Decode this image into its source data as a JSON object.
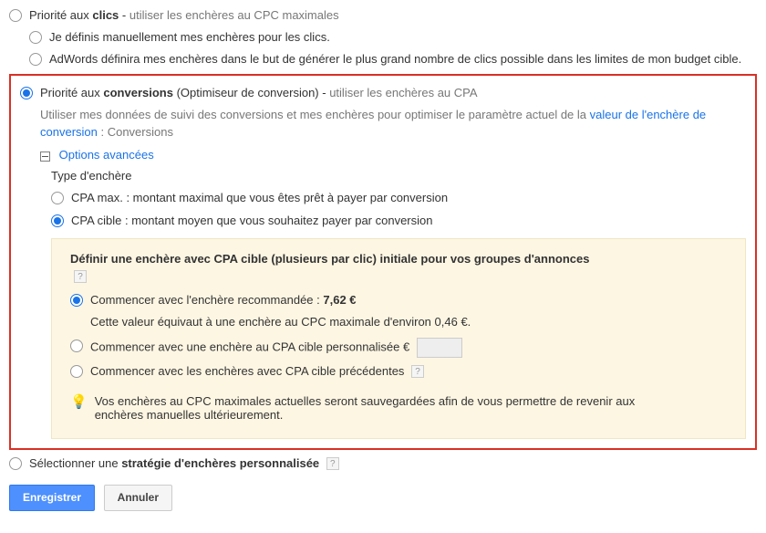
{
  "option_clicks": {
    "prefix": "Priorité aux ",
    "bold": "clics",
    "suffix": " - ",
    "hint": "utiliser les enchères au CPC maximales",
    "sub1": "Je définis manuellement mes enchères pour les clics.",
    "sub2": "AdWords définira mes enchères dans le but de générer le plus grand nombre de clics possible dans les limites de mon budget cible."
  },
  "option_conversions": {
    "prefix": "Priorité aux ",
    "bold": "conversions",
    "paren": " (Optimiseur de conversion) - ",
    "hint": "utiliser les enchères au CPA",
    "desc_pre": "Utiliser mes données de suivi des conversions et mes enchères pour optimiser le paramètre actuel de la ",
    "link": "valeur de l'enchère de conversion",
    "desc_post": " : Conversions"
  },
  "advanced": {
    "label": "Options avancées",
    "bid_type": "Type d'enchère",
    "cpa_max": "CPA max. : montant maximal que vous êtes prêt à payer par conversion",
    "cpa_target": "CPA cible : montant moyen que vous souhaitez payer par conversion"
  },
  "panel": {
    "title": "Définir une enchère avec CPA cible (plusieurs par clic) initiale pour vos groupes d'annonces",
    "rec_pre": "Commencer avec l'enchère recommandée : ",
    "rec_val": "7,62 €",
    "rec_note": "Cette valeur équivaut à une enchère au CPC maximale d'environ 0,46 €.",
    "custom": "Commencer avec une enchère au CPA cible personnalisée €",
    "previous": "Commencer avec les enchères avec CPA cible précédentes",
    "hint": "Vos enchères au CPC maximales actuelles seront sauvegardées afin de vous permettre de revenir aux enchères manuelles ultérieurement."
  },
  "option_custom_strategy": {
    "prefix": "Sélectionner une ",
    "bold": "stratégie d'enchères personnalisée"
  },
  "buttons": {
    "save": "Enregistrer",
    "cancel": "Annuler"
  }
}
